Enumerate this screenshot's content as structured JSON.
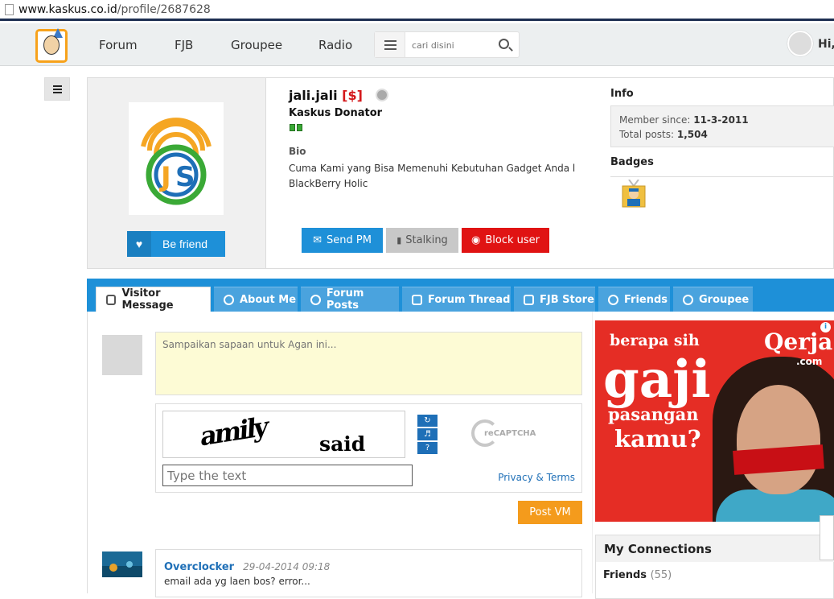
{
  "browser": {
    "url_domain": "www.kaskus.co.id",
    "url_path": "/profile/2687628"
  },
  "nav": {
    "items": [
      "Forum",
      "FJB",
      "Groupee",
      "Radio"
    ],
    "search_placeholder": "cari disini",
    "greeting": "Hi,"
  },
  "profile": {
    "username": "jali.jali",
    "tag": "[$]",
    "title": "Kaskus Donator",
    "bio_label": "Bio",
    "bio": "Cuma Kami yang Bisa Memenuhi Kebutuhan Gadget Anda l BlackBerry Holic",
    "befriend_label": "Be friend",
    "send_pm_label": "Send PM",
    "stalking_label": "Stalking",
    "block_label": "Block user"
  },
  "info": {
    "heading": "Info",
    "member_since_label": "Member since:",
    "member_since": "11-3-2011",
    "total_posts_label": "Total posts:",
    "total_posts": "1,504",
    "badges_heading": "Badges"
  },
  "tabs": [
    "Visitor Message",
    "About Me",
    "Forum Posts",
    "Forum Thread",
    "FJB Store",
    "Friends",
    "Groupee"
  ],
  "visitor": {
    "placeholder": "Sampaikan sapaan untuk Agan ini...",
    "captcha_word1": "amily",
    "captcha_word2": "said",
    "captcha_input_placeholder": "Type the text",
    "privacy_label": "Privacy & Terms",
    "recaptcha_label": "reCAPTCHA",
    "post_label": "Post VM"
  },
  "message": {
    "author": "Overclocker",
    "date": "29-04-2014 09:18",
    "text": "email ada yg laen bos? error..."
  },
  "ad": {
    "line1": "berapa sih",
    "line2": "gaji",
    "line3": "pasangan",
    "line4": "kamu?",
    "brand": "Qerja",
    "brand_sub": ".com"
  },
  "connections": {
    "heading": "My Connections",
    "friends_label": "Friends",
    "friends_count": "(55)"
  }
}
